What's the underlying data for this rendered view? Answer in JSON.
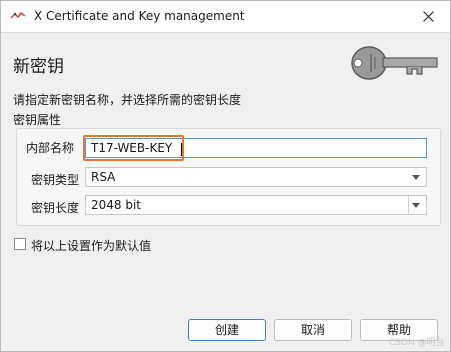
{
  "window": {
    "title": "X Certificate and Key management",
    "icons": {
      "app": "xca-app-icon",
      "close": "close-icon",
      "key": "key-icon"
    }
  },
  "header": {
    "heading": "新密钥",
    "description": "请指定新密钥名称，并选择所需的密钥长度",
    "section_label": "密钥属性"
  },
  "form": {
    "internal_name": {
      "label": "内部名称",
      "value": "T17-WEB-KEY"
    },
    "key_type": {
      "label": "密钥类型",
      "value": "RSA"
    },
    "key_length": {
      "label": "密钥长度",
      "value": "2048 bit"
    }
  },
  "options": {
    "remember_default": {
      "label": "将以上设置作为默认值",
      "checked": false
    }
  },
  "buttons": {
    "create": "创建",
    "cancel": "取消",
    "help": "帮助"
  },
  "watermark": "CSDN @明台",
  "colors": {
    "focus_highlight": "#e8762d",
    "default_button_border": "#3c7fc7"
  }
}
